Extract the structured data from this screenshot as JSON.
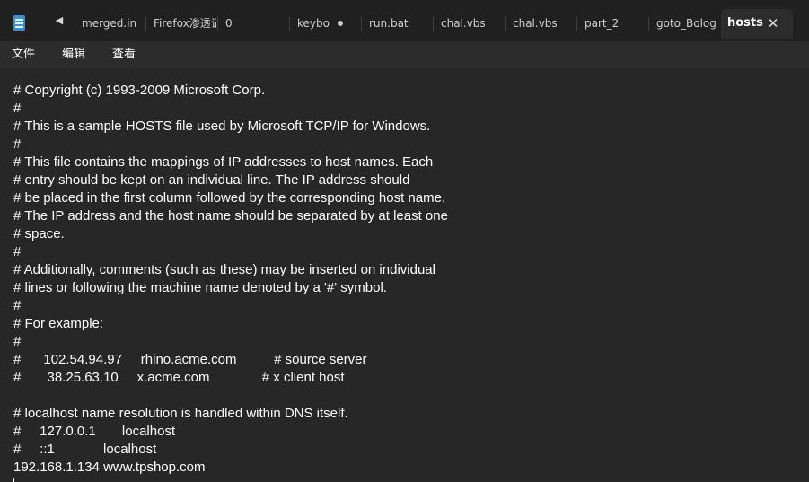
{
  "tabs": [
    {
      "label": "merged.ini"
    },
    {
      "label": "Firefox渗透记"
    },
    {
      "label": "0"
    },
    {
      "label": "keyboa"
    },
    {
      "label": "run.bat"
    },
    {
      "label": "chal.vbs"
    },
    {
      "label": "chal.vbs"
    },
    {
      "label": "part_2"
    },
    {
      "label": "goto_Bologs"
    },
    {
      "label": "hosts"
    }
  ],
  "icons": {
    "app": "notepad-icon",
    "scroll_left": "triangle-left-icon",
    "close": "close-icon",
    "modified": "unsaved-dot-icon"
  },
  "tab_close_glyph": "✕",
  "scroll_left_glyph": "◀",
  "menu": {
    "file": "文件",
    "edit": "编辑",
    "view": "查看"
  },
  "document": {
    "lines": [
      "# Copyright (c) 1993-2009 Microsoft Corp.",
      "#",
      "# This is a sample HOSTS file used by Microsoft TCP/IP for Windows.",
      "#",
      "# This file contains the mappings of IP addresses to host names. Each",
      "# entry should be kept on an individual line. The IP address should",
      "# be placed in the first column followed by the corresponding host name.",
      "# The IP address and the host name should be separated by at least one",
      "# space.",
      "#",
      "# Additionally, comments (such as these) may be inserted on individual",
      "# lines or following the machine name denoted by a '#' symbol.",
      "#",
      "# For example:",
      "#",
      "#      102.54.94.97     rhino.acme.com          # source server",
      "#       38.25.63.10     x.acme.com              # x client host",
      "",
      "# localhost name resolution is handled within DNS itself.",
      "#     127.0.0.1       localhost",
      "#     ::1             localhost",
      "192.168.1.134 www.tpshop.com"
    ]
  },
  "colors": {
    "background": "#272727",
    "tabbar": "#202020",
    "text": "#ffffff"
  }
}
